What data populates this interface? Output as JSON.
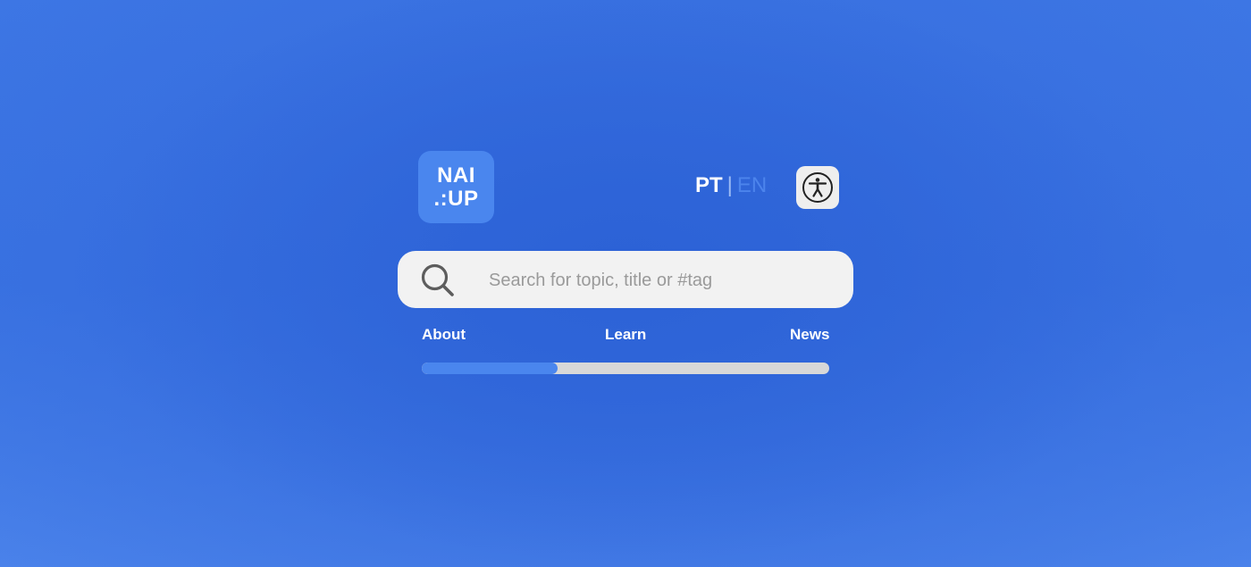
{
  "logo": {
    "line1": "NAI",
    "line2": ".:UP"
  },
  "language": {
    "active": "PT",
    "separator": "|",
    "inactive": "EN"
  },
  "accessibility": {
    "icon": "accessibility-icon"
  },
  "search": {
    "icon": "search-icon",
    "placeholder": "Search for topic, title or #tag",
    "value": ""
  },
  "nav": {
    "items": [
      {
        "label": "About"
      },
      {
        "label": "Learn"
      },
      {
        "label": "News"
      }
    ]
  },
  "progress": {
    "fraction": 0.333
  },
  "colors": {
    "background": "#3a73e2",
    "accent": "#4a86ee",
    "search_bg": "#f2f2f2",
    "track": "#d8d8d8"
  }
}
